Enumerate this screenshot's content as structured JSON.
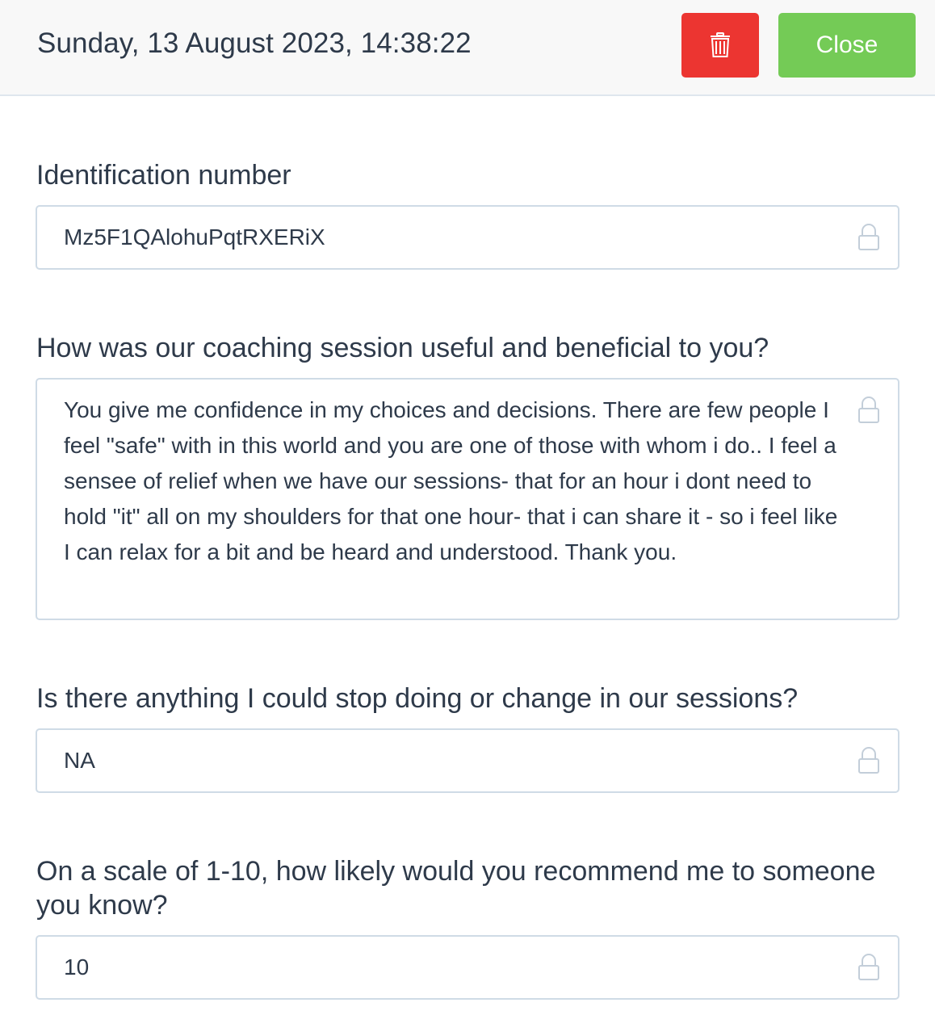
{
  "header": {
    "timestamp": "Sunday, 13 August 2023, 14:38:22",
    "delete_icon": "trash-icon",
    "close_label": "Close"
  },
  "fields": [
    {
      "label": "Identification number",
      "value": "Mz5F1QAlohuPqtRXERiX",
      "icon": "lock-icon"
    },
    {
      "label": "How was our coaching session useful and beneficial to you?",
      "value": "You give me confidence in my choices and decisions. There are few people I feel \"safe\" with in this world and you are one of those with whom i do.. I feel a sensee of relief when we have our sessions- that for an hour i dont need to hold \"it\" all on my shoulders for that one hour- that i can share it - so i feel like I can relax for a bit and be heard and understood. Thank you.",
      "icon": "lock-icon"
    },
    {
      "label": "Is there anything I could stop doing or change in our sessions?",
      "value": "NA",
      "icon": "lock-icon"
    },
    {
      "label": "On a scale of 1-10, how likely would you recommend me to someone you know?",
      "value": "10",
      "icon": "lock-icon"
    }
  ],
  "colors": {
    "delete": "#ec3531",
    "close": "#74cb56",
    "border": "#cfdbe6"
  }
}
